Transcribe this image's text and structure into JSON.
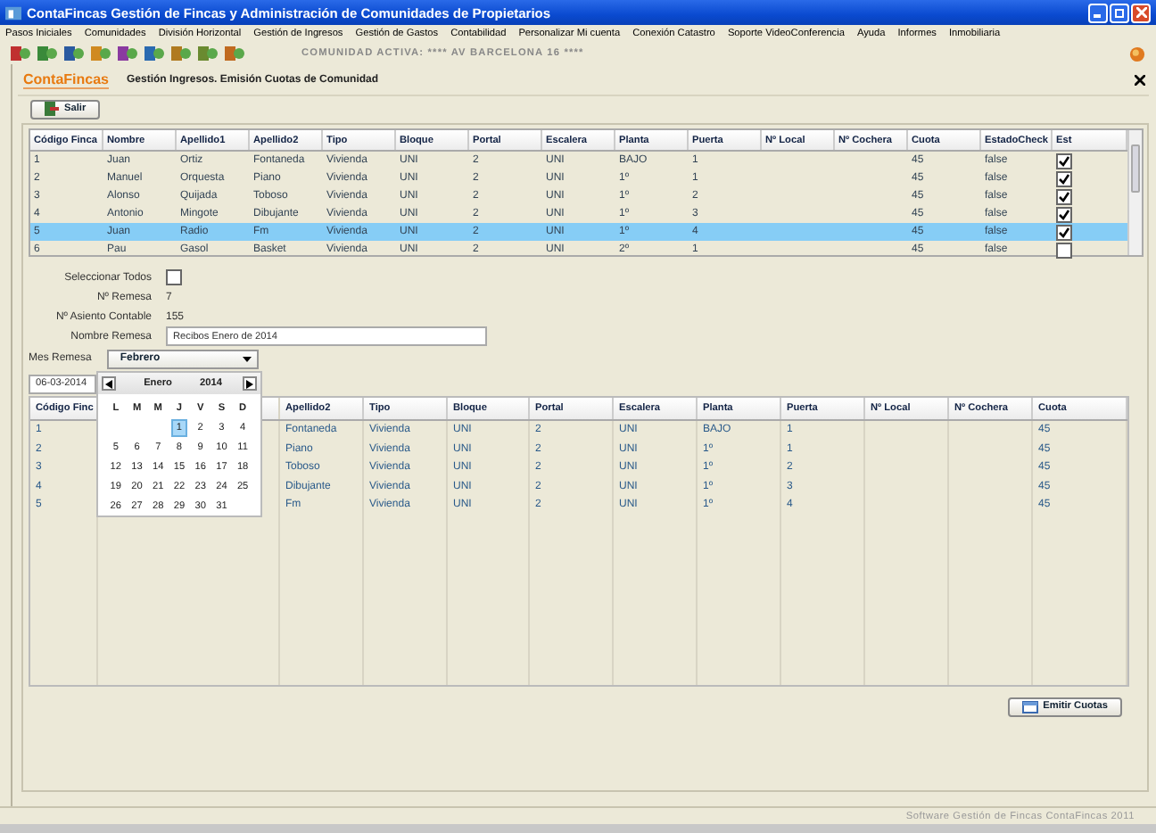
{
  "window": {
    "title": "ContaFincas Gestión de Fincas y Administración de Comunidades de Propietarios"
  },
  "menu": [
    "Pasos Iniciales",
    "Comunidades",
    "División Horizontal",
    "Gestión de Ingresos",
    "Gestión de Gastos",
    "Contabilidad",
    "Personalizar Mi cuenta",
    "Conexión Catastro",
    "Soporte VideoConferencia",
    "Ayuda",
    "Informes",
    "Inmobiliaria"
  ],
  "active_community": "COMUNIDAD ACTIVA:  **** AV BARCELONA 16 ****",
  "logo": "ContaFincas",
  "panel_title": "Gestión Ingresos. Emisión Cuotas de Comunidad",
  "exit_button": "Salir",
  "top_table": {
    "columns": [
      "Código Finca",
      "Nombre",
      "Apellido1",
      "Apellido2",
      "Tipo",
      "Bloque",
      "Portal",
      "Escalera",
      "Planta",
      "Puerta",
      "Nº Local",
      "Nº Cochera",
      "Cuota",
      "EstadoCheck",
      "Est"
    ],
    "rows": [
      {
        "cells": [
          "1",
          "Juan",
          "Ortiz",
          "Fontaneda",
          "Vivienda",
          "UNI",
          "2",
          "UNI",
          "BAJO",
          "1"
        ],
        "cuota": "45",
        "estado": "false",
        "checked": true,
        "selected": false
      },
      {
        "cells": [
          "2",
          "Manuel",
          "Orquesta",
          "Piano",
          "Vivienda",
          "UNI",
          "2",
          "UNI",
          "1º",
          "1"
        ],
        "cuota": "45",
        "estado": "false",
        "checked": true,
        "selected": false
      },
      {
        "cells": [
          "3",
          "Alonso",
          "Quijada",
          "Toboso",
          "Vivienda",
          "UNI",
          "2",
          "UNI",
          "1º",
          "2"
        ],
        "cuota": "45",
        "estado": "false",
        "checked": true,
        "selected": false
      },
      {
        "cells": [
          "4",
          "Antonio",
          "Mingote",
          "Dibujante",
          "Vivienda",
          "UNI",
          "2",
          "UNI",
          "1º",
          "3"
        ],
        "cuota": "45",
        "estado": "false",
        "checked": true,
        "selected": false
      },
      {
        "cells": [
          "5",
          "Juan",
          "Radio",
          "Fm",
          "Vivienda",
          "UNI",
          "2",
          "UNI",
          "1º",
          "4"
        ],
        "cuota": "45",
        "estado": "false",
        "checked": true,
        "selected": true
      },
      {
        "cells": [
          "6",
          "Pau",
          "Gasol",
          "Basket",
          "Vivienda",
          "UNI",
          "2",
          "UNI",
          "2º",
          "1"
        ],
        "cuota": "45",
        "estado": "false",
        "checked": false,
        "selected": false
      }
    ]
  },
  "form": {
    "select_all": {
      "label": "Seleccionar Todos",
      "checked": false
    },
    "remesa_number": {
      "label": "Nº Remesa",
      "value": "7"
    },
    "entry_number": {
      "label": "Nº Asiento Contable",
      "value": "155"
    },
    "remesa_name": {
      "label": "Nombre Remesa",
      "value": "Recibos Enero de 2014"
    },
    "month": {
      "label": "Mes Remesa",
      "value": "Febrero"
    },
    "date": "06-03-2014"
  },
  "calendar": {
    "month": "Enero",
    "year": "2014",
    "weekdays": [
      "L",
      "M",
      "M",
      "J",
      "V",
      "S",
      "D"
    ],
    "weeks": [
      [
        {
          "day": "1",
          "selected": true
        },
        {
          "day": "2",
          "selected": false
        },
        {
          "day": "3",
          "selected": false
        },
        {
          "day": "4",
          "selected": false
        }
      ],
      [
        {
          "day": "5",
          "selected": false
        },
        {
          "day": "6",
          "selected": false
        },
        {
          "day": "7",
          "selected": false
        },
        {
          "day": "8",
          "selected": false
        },
        {
          "day": "9",
          "selected": false
        },
        {
          "day": "10",
          "selected": false
        },
        {
          "day": "11",
          "selected": false
        }
      ],
      [
        {
          "day": "12",
          "selected": false
        },
        {
          "day": "13",
          "selected": false
        },
        {
          "day": "14",
          "selected": false
        },
        {
          "day": "15",
          "selected": false
        },
        {
          "day": "16",
          "selected": false
        },
        {
          "day": "17",
          "selected": false
        },
        {
          "day": "18",
          "selected": false
        }
      ],
      [
        {
          "day": "19",
          "selected": false
        },
        {
          "day": "20",
          "selected": false
        },
        {
          "day": "21",
          "selected": false
        },
        {
          "day": "22",
          "selected": false
        },
        {
          "day": "23",
          "selected": false
        },
        {
          "day": "24",
          "selected": false
        },
        {
          "day": "25",
          "selected": false
        }
      ],
      [
        {
          "day": "26",
          "selected": false
        },
        {
          "day": "27",
          "selected": false
        },
        {
          "day": "28",
          "selected": false
        },
        {
          "day": "29",
          "selected": false
        },
        {
          "day": "30",
          "selected": false
        },
        {
          "day": "31",
          "selected": false
        }
      ]
    ]
  },
  "bottom_table": {
    "columns": [
      "Código Finc",
      "Apellido2",
      "Tipo",
      "Bloque",
      "Portal",
      "Escalera",
      "Planta",
      "Puerta",
      "Nº Local",
      "Nº Cochera",
      "Cuota"
    ],
    "rows": [
      {
        "cells": [
          "1",
          "Fontaneda",
          "Vivienda",
          "UNI",
          "2",
          "UNI",
          "BAJO",
          "1",
          "",
          "",
          "45"
        ]
      },
      {
        "cells": [
          "2",
          "Piano",
          "Vivienda",
          "UNI",
          "2",
          "UNI",
          "1º",
          "1",
          "",
          "",
          "45"
        ]
      },
      {
        "cells": [
          "3",
          "Toboso",
          "Vivienda",
          "UNI",
          "2",
          "UNI",
          "1º",
          "2",
          "",
          "",
          "45"
        ]
      },
      {
        "cells": [
          "4",
          "Dibujante",
          "Vivienda",
          "UNI",
          "2",
          "UNI",
          "1º",
          "3",
          "",
          "",
          "45"
        ]
      },
      {
        "cells": [
          "5",
          "Fm",
          "Vivienda",
          "UNI",
          "2",
          "UNI",
          "1º",
          "4",
          "",
          "",
          "45"
        ]
      }
    ]
  },
  "emit_button": "Emitir Cuotas",
  "status_bar": "Software Gestión de Fincas ContaFincas 2011"
}
